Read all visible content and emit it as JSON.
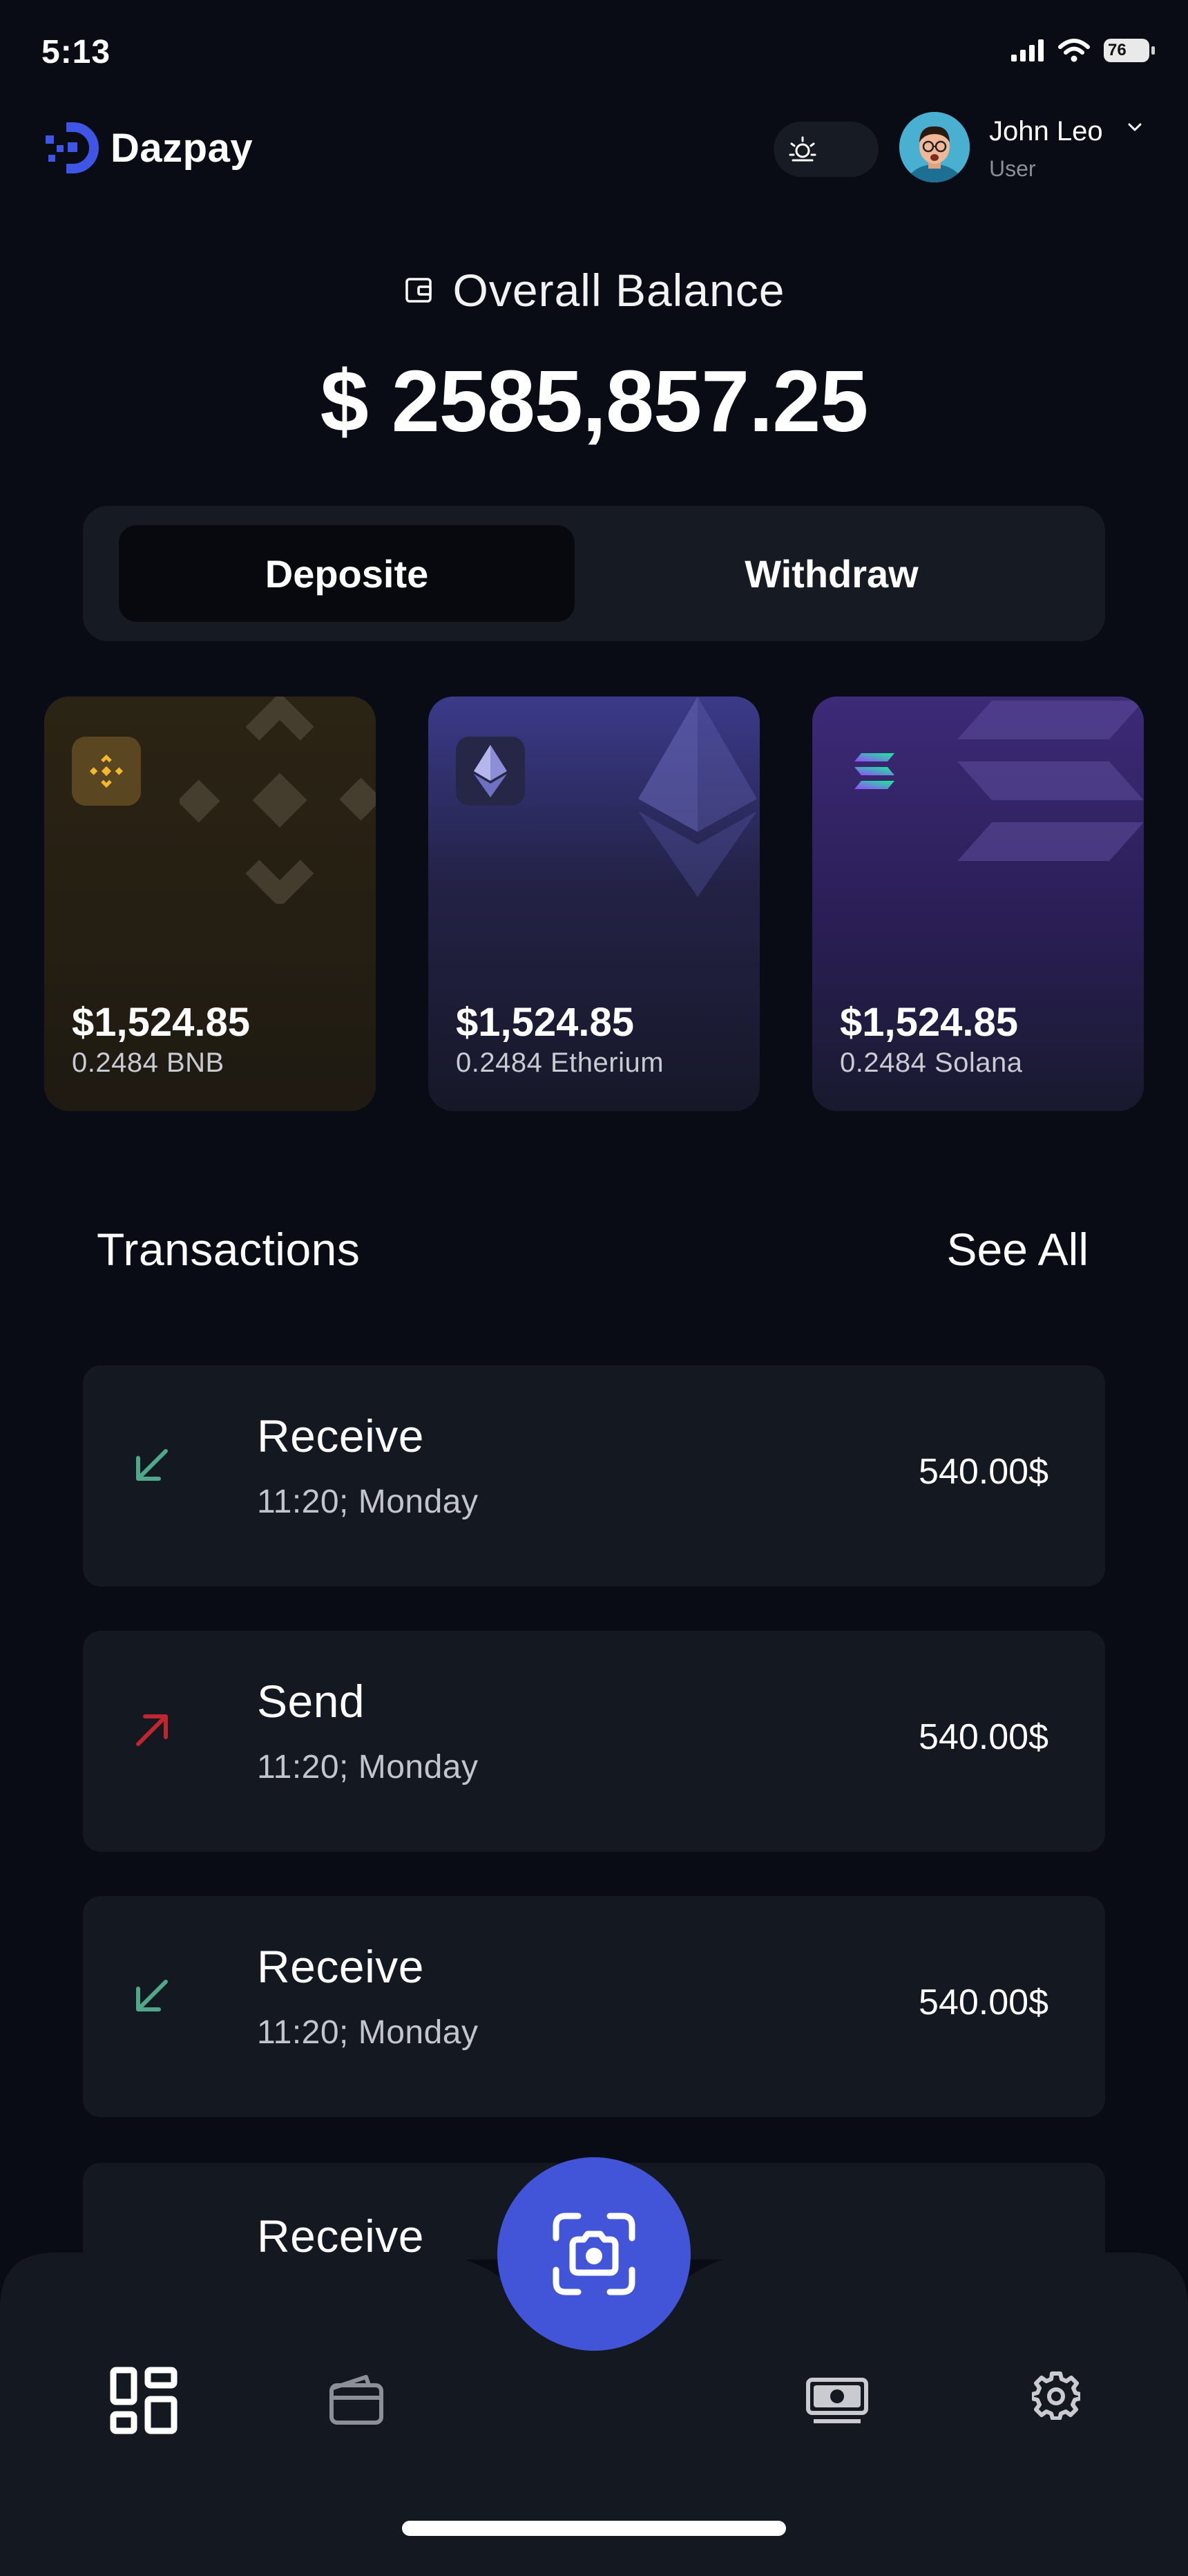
{
  "status_bar": {
    "time": "5:13",
    "battery": "76"
  },
  "header": {
    "app_name": "Dazpay",
    "user_name": "John Leo",
    "user_role": "User",
    "icons": {
      "logo": "dazpay-logo-icon",
      "theme": "sun-icon",
      "chevron": "chevron-down-icon"
    }
  },
  "balance": {
    "label": "Overall Balance",
    "amount": "$ 2585,857.25",
    "icon": "wallet-icon"
  },
  "segments": {
    "deposit": "Deposite",
    "withdraw": "Withdraw",
    "selected": "deposit"
  },
  "cards": [
    {
      "usd": "$1,524.85",
      "amount": "0.2484 BNB",
      "icon": "bnb-icon",
      "accent": "#f3ba2f"
    },
    {
      "usd": "$1,524.85",
      "amount": "0.2484 Etherium",
      "icon": "ethereum-icon",
      "accent": "#8a8fd8"
    },
    {
      "usd": "$1,524.85",
      "amount": "0.2484 Solana",
      "icon": "solana-icon",
      "accent": "#14f195"
    }
  ],
  "transactions": {
    "title": "Transactions",
    "see_all": "See All",
    "items": [
      {
        "type": "Receive",
        "time": "11:20; Monday",
        "amount": "540.00$",
        "direction": "in"
      },
      {
        "type": "Send",
        "time": "11:20; Monday",
        "amount": "540.00$",
        "direction": "out"
      },
      {
        "type": "Receive",
        "time": "11:20; Monday",
        "amount": "540.00$",
        "direction": "in"
      },
      {
        "type": "Receive",
        "time": "",
        "amount": "",
        "direction": "in"
      }
    ]
  },
  "nav": {
    "items": [
      "dashboard-icon",
      "wallet-icon",
      "camera-icon",
      "cash-icon",
      "settings-icon"
    ],
    "active": "dashboard-icon"
  },
  "colors": {
    "background": "#090c14",
    "card": "#141820",
    "primary": "#4255d8",
    "receive": "#4fa88a",
    "send": "#c0262d"
  }
}
